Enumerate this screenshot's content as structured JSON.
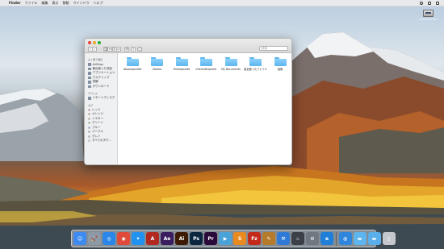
{
  "menubar": {
    "apple_glyph": "",
    "app_name": "Finder",
    "menus": [
      "ファイル",
      "編集",
      "表示",
      "移動",
      "ウインドウ",
      "ヘルプ"
    ],
    "status_icons": [
      "search-icon",
      "list-icon",
      "menu-icon"
    ]
  },
  "desktop": {
    "hd_label": "Macintosh HD"
  },
  "finder": {
    "title": "",
    "search_placeholder": "検索",
    "toolbar_glyphs": {
      "back": "‹",
      "forward": "›",
      "view_icon": "▦",
      "view_list": "≡",
      "view_column": "⫼",
      "view_gallery": "▭",
      "arrange": "⚙",
      "share": "⇪",
      "tag": "◯"
    },
    "sidebar": {
      "favorites_heading": "よく使う項目",
      "favorites": [
        "AirDrop",
        "最近使った項目",
        "アプリケーション",
        "デスクトップ",
        "書類",
        "ダウンロード"
      ],
      "devices_heading": "デバイス",
      "devices": [
        "リモートディスク"
      ],
      "tags_heading": "タグ",
      "tags": [
        {
          "label": "レッド",
          "color": "#fc5f57"
        },
        {
          "label": "オレンジ",
          "color": "#fd9a2f"
        },
        {
          "label": "イエロー",
          "color": "#f7d230"
        },
        {
          "label": "グリーン",
          "color": "#5ed35c"
        },
        {
          "label": "ブルー",
          "color": "#3fa2f7"
        },
        {
          "label": "パープル",
          "color": "#c77ddc"
        },
        {
          "label": "グレイ",
          "color": "#a5a5a5"
        },
        {
          "label": "すべてのタグ...",
          "color": "#ffffff"
        }
      ]
    },
    "folders": [
      {
        "label": "aksampprofile"
      },
      {
        "label": "Dotbro"
      },
      {
        "label": "Firefoxprofile"
      },
      {
        "label": "InternetExplorer"
      },
      {
        "label": "My Documents"
      },
      {
        "label": "最近使ったファイル"
      },
      {
        "label": "画像"
      }
    ]
  },
  "dock": {
    "items": [
      {
        "name": "finder",
        "glyph": "☺",
        "color": "#3d8bf0"
      },
      {
        "name": "launchpad",
        "glyph": "🚀",
        "color": "#8d9aa6"
      },
      {
        "name": "safari-like",
        "glyph": "◎",
        "color": "#2a86e8"
      },
      {
        "name": "chrome",
        "glyph": "◉",
        "color": "#e04a3a"
      },
      {
        "name": "safari",
        "glyph": "✦",
        "color": "#2192f0"
      },
      {
        "name": "acrobat",
        "glyph": "A",
        "color": "#b0281f"
      },
      {
        "name": "after-effects",
        "glyph": "Ae",
        "color": "#3a1d5e"
      },
      {
        "name": "illustrator",
        "glyph": "Ai",
        "color": "#3d1a04"
      },
      {
        "name": "photoshop",
        "glyph": "Ps",
        "color": "#0b2740"
      },
      {
        "name": "premiere",
        "glyph": "Pr",
        "color": "#2a0a3a"
      },
      {
        "name": "sublime",
        "glyph": "▶",
        "color": "#4aa3d8"
      },
      {
        "name": "sublime-text",
        "glyph": "S",
        "color": "#e88a1f"
      },
      {
        "name": "filezilla",
        "glyph": "Fz",
        "color": "#c42a1c"
      },
      {
        "name": "tool",
        "glyph": "✎",
        "color": "#b57a2a"
      },
      {
        "name": "xcode",
        "glyph": "⚒",
        "color": "#2f7ad6"
      },
      {
        "name": "steam",
        "glyph": "♨",
        "color": "#3a3f48"
      },
      {
        "name": "settings",
        "glyph": "⚙",
        "color": "#6f7780"
      },
      {
        "name": "edge",
        "glyph": "e",
        "color": "#1f7fd8"
      },
      {
        "name": "globe",
        "glyph": "◍",
        "color": "#2f86dc"
      },
      {
        "name": "folder",
        "glyph": "▬",
        "color": "#5eb5ee"
      },
      {
        "name": "downloads",
        "glyph": "▬",
        "color": "#5aaeea"
      },
      {
        "name": "trash",
        "glyph": "▯",
        "color": "#c4c8cc"
      }
    ]
  }
}
